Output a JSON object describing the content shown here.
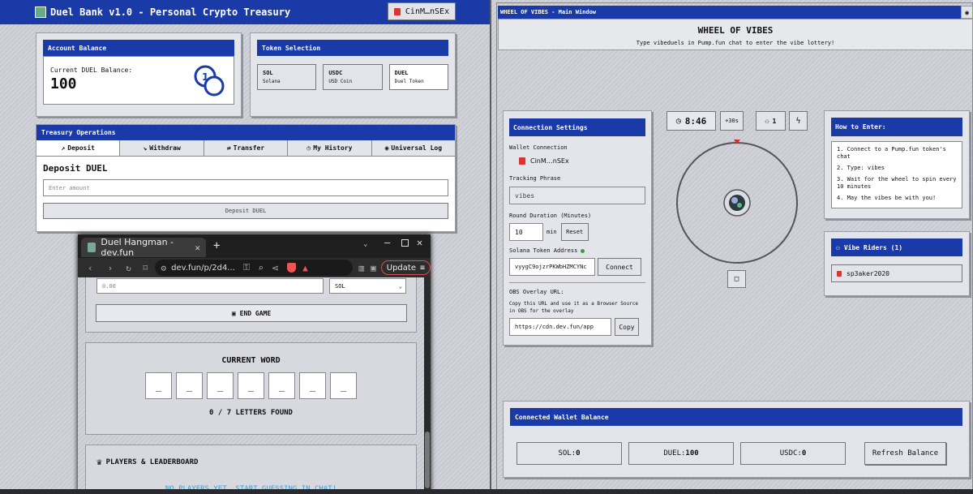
{
  "left_app": {
    "title": "Duel Bank v1.0 - Personal Crypto Treasury",
    "wallet_label": "CinM…nSEx",
    "account": {
      "header": "Account Balance",
      "label": "Current DUEL Balance:",
      "value": "100"
    },
    "tokens": {
      "header": "Token Selection",
      "items": [
        {
          "symbol": "SOL",
          "name": "Solana"
        },
        {
          "symbol": "USDC",
          "name": "USD Coin"
        },
        {
          "symbol": "DUEL",
          "name": "Duel Token"
        }
      ]
    },
    "treasury": {
      "header": "Treasury Operations",
      "tabs": [
        "Deposit",
        "Withdraw",
        "Transfer",
        "My History",
        "Universal Log"
      ],
      "heading": "Deposit DUEL",
      "amount_placeholder": "Enter amount",
      "submit": "Deposit DUEL"
    }
  },
  "browser": {
    "tab_title": "Duel Hangman - dev.fun",
    "url": "dev.fun/p/2d4...",
    "update_label": "Update",
    "hangman": {
      "amount_placeholder": "0.00",
      "currency": "SOL",
      "end_game": "END GAME",
      "current_word_title": "CURRENT WORD",
      "letters": [
        "_",
        "_",
        "_",
        "_",
        "_",
        "_",
        "_"
      ],
      "found": "0 / 7 LETTERS FOUND",
      "leaderboard_title": "PLAYERS & LEADERBOARD",
      "empty_msg": "NO PLAYERS YET. START GUESSING IN CHAT!"
    }
  },
  "right_app": {
    "window_title": "WHEEL OF VIBES - Main Window",
    "title": "WHEEL OF VIBES",
    "subtitle": "Type vibeduels in Pump.fun chat to enter the vibe lottery!",
    "connection": {
      "header": "Connection Settings",
      "wallet_label": "Wallet Connection",
      "wallet": "CinM…nSEx",
      "phrase_label": "Tracking Phrase",
      "phrase_value": "vibes",
      "duration_label": "Round Duration (Minutes)",
      "duration_value": "10",
      "duration_unit": "min",
      "reset": "Reset",
      "token_label": "Solana Token Address",
      "token_value": "vyygC9ojzrPKWbHZMCYNc",
      "connect": "Connect",
      "obs_label": "OBS Overlay URL:",
      "obs_desc": "Copy this URL and use it as a Browser Source in OBS for the overlay",
      "obs_value": "https://cdn.dev.fun/app",
      "copy": "Copy"
    },
    "timer": {
      "value": "8:46",
      "add": "+30s",
      "players": "1"
    },
    "how": {
      "header": "How to Enter:",
      "steps": [
        "1. Connect to a Pump.fun token's chat",
        "2. Type: vibes",
        "3. Wait for the wheel to spin every 10 minutes",
        "4. May the vibes be with you!"
      ]
    },
    "riders": {
      "header": "Vibe Riders (1)",
      "items": [
        "sp3aker2020"
      ]
    },
    "balance": {
      "header": "Connected Wallet Balance",
      "items": [
        {
          "label": "SOL:",
          "value": "0"
        },
        {
          "label": "DUEL:",
          "value": "100"
        },
        {
          "label": "USDC:",
          "value": "0"
        }
      ],
      "refresh": "Refresh Balance"
    }
  },
  "colors": {
    "accent": "#1a3aa8",
    "hatch": "#c9cbd2",
    "browser_chrome": "#1f1f1f",
    "connected": "#3a9a4a"
  }
}
